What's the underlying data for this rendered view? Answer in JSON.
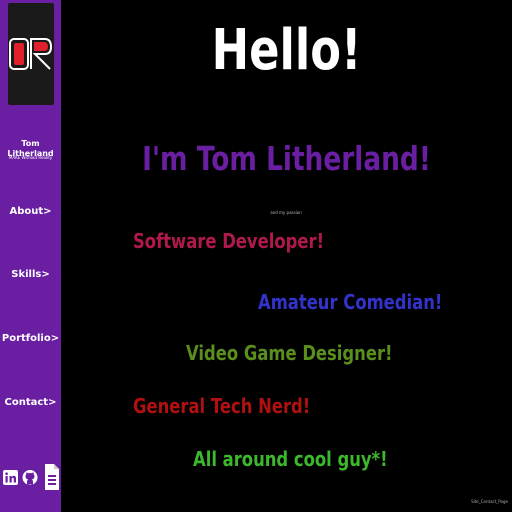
{
  "sidebar": {
    "logo_text": "OR",
    "name": "Tom Litherland",
    "subtitle": "MAKE Without Reality",
    "nav": [
      {
        "label": "About>"
      },
      {
        "label": "Skills>"
      },
      {
        "label": "Portfolio>"
      },
      {
        "label": "Contact>"
      }
    ],
    "social_icons": [
      "linkedin-icon",
      "github-icon",
      "document-icon"
    ]
  },
  "main": {
    "greeting": "Hello!",
    "intro": "I'm Tom Litherland!",
    "bio_snippet": "and my passion",
    "roles": [
      {
        "text": "Software Developer!",
        "color": "#b0184e"
      },
      {
        "text": "Amateur Comedian!",
        "color": "#3333cc"
      },
      {
        "text": "Video Game Designer!",
        "color": "#5a8f1e"
      },
      {
        "text": "General Tech Nerd!",
        "color": "#b01010"
      },
      {
        "text": "All around cool guy*!",
        "color": "#3cb82c"
      }
    ],
    "footer": "Site_Contact_Page"
  },
  "colors": {
    "sidebar_bg": "#6a1fa3",
    "logo_accent": "#e0202a",
    "background": "#000000"
  }
}
